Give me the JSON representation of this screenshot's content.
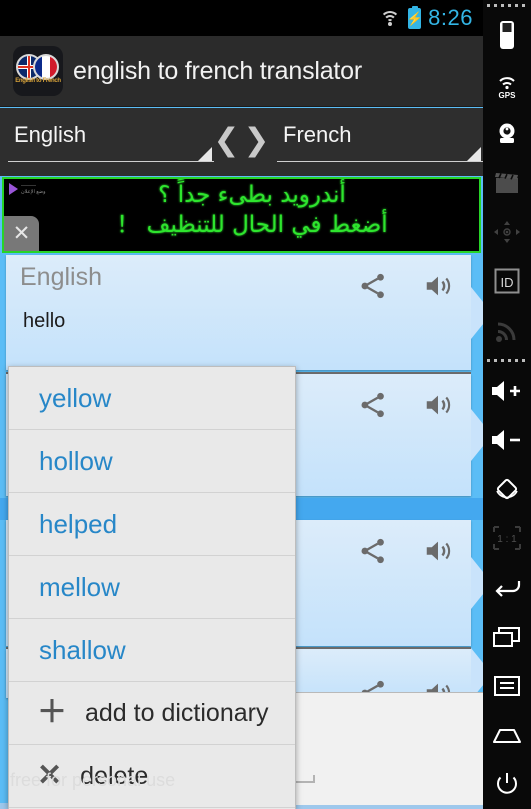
{
  "status_bar": {
    "time": "8:26",
    "battery_glyph": "⚡",
    "wifi_icon": "wifi-icon",
    "battery_icon": "battery-charging-icon"
  },
  "action_bar": {
    "title": "english to french translator",
    "icon_caption": "English to French",
    "app_icon": "app-icon"
  },
  "language_bar": {
    "source_language": "English",
    "target_language": "French",
    "swap_left_glyph": "❮",
    "swap_right_glyph": "❯"
  },
  "ad": {
    "line1": "أندرويد بطىء جداً ؟",
    "line2": "أضغط في الحال للتنظيف ！",
    "google_play_line1": "———",
    "google_play_line2": "وضع الإعلان",
    "close_glyph": "✕",
    "border_color": "#27d427",
    "text_color": "#2ee52e"
  },
  "cards": [
    {
      "label": "English",
      "text": "hello",
      "share_icon": "share-icon",
      "speaker_icon": "speaker-icon"
    },
    {
      "label": "",
      "text": "",
      "share_icon": "share-icon",
      "speaker_icon": "speaker-icon"
    },
    {
      "label": "",
      "text": "",
      "share_icon": "share-icon",
      "speaker_icon": "speaker-icon"
    },
    {
      "label": "",
      "text": "",
      "share_icon": "share-icon",
      "speaker_icon": "speaker-icon"
    }
  ],
  "suggestions": {
    "words": [
      "yellow",
      "hollow",
      "helped",
      "mellow",
      "shallow"
    ],
    "actions": [
      {
        "label": "add to dictionary",
        "glyph": "＋",
        "icon": "plus-icon"
      },
      {
        "label": "delete",
        "glyph": "✕",
        "icon": "cross-icon"
      }
    ]
  },
  "input_row": {
    "value": "",
    "placeholder": "",
    "send_icon": "arrow-right-icon"
  },
  "watermark": "free for personal use",
  "sidebar": {
    "items": [
      {
        "name": "device-icon",
        "glyph": "device"
      },
      {
        "name": "gps-icon",
        "glyph": "GPS"
      },
      {
        "name": "camera-icon",
        "glyph": "camera"
      },
      {
        "name": "clapperboard-icon",
        "glyph": "clapper"
      },
      {
        "name": "dpad-icon",
        "glyph": "dpad"
      },
      {
        "name": "id-icon",
        "glyph": "ID"
      },
      {
        "name": "rss-icon",
        "glyph": "rss"
      },
      {
        "name": "volume-up-icon",
        "glyph": "vol+"
      },
      {
        "name": "volume-down-icon",
        "glyph": "vol-"
      },
      {
        "name": "rotate-icon",
        "glyph": "rotate"
      },
      {
        "name": "scale-one-to-one-icon",
        "glyph": "1 : 1"
      },
      {
        "name": "back-icon",
        "glyph": "back"
      },
      {
        "name": "recents-icon",
        "glyph": "recents"
      },
      {
        "name": "menu-icon",
        "glyph": "menu"
      },
      {
        "name": "home-icon",
        "glyph": "home"
      },
      {
        "name": "power-icon",
        "glyph": "power"
      }
    ]
  },
  "colors": {
    "accent_blue": "#33b5e5",
    "app_background": "#5bbdf6",
    "card_background": "#c9e3fb",
    "suggestion_text": "#2787c8",
    "ad_green": "#2ee52e"
  }
}
